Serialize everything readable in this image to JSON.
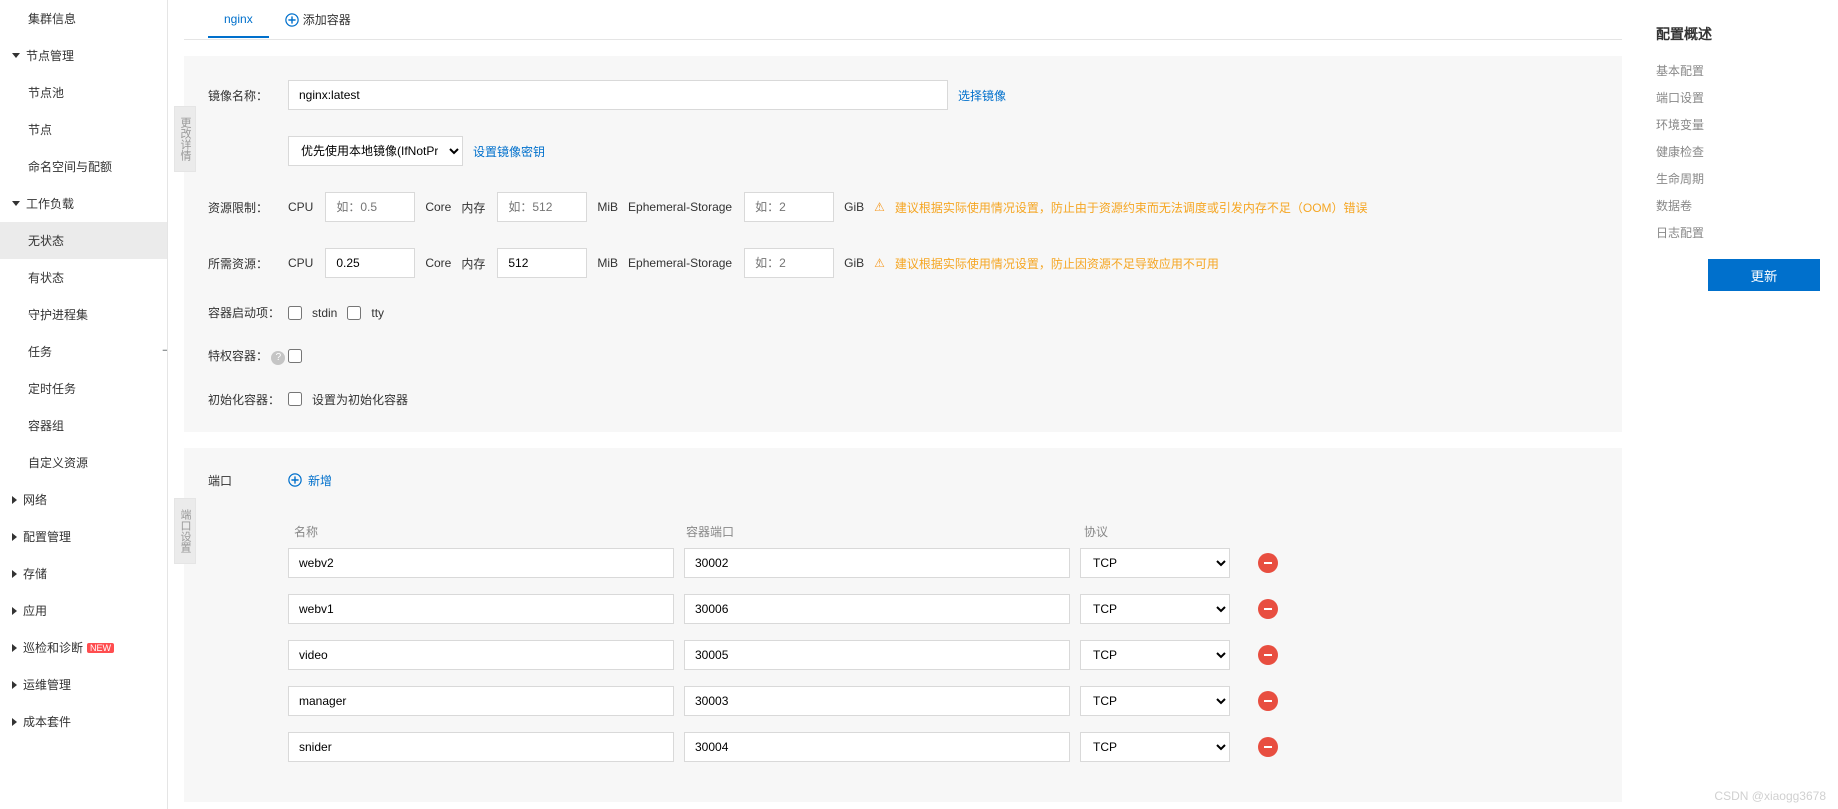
{
  "sidebar": {
    "items": [
      {
        "label": "集群信息"
      },
      {
        "label": "节点管理",
        "expanded": true,
        "children": [
          {
            "label": "节点池"
          },
          {
            "label": "节点"
          },
          {
            "label": "命名空间与配额"
          }
        ]
      },
      {
        "label": "工作负载",
        "expanded": true,
        "children": [
          {
            "label": "无状态",
            "active": true
          },
          {
            "label": "有状态"
          },
          {
            "label": "守护进程集"
          },
          {
            "label": "任务"
          },
          {
            "label": "定时任务"
          },
          {
            "label": "容器组"
          },
          {
            "label": "自定义资源"
          }
        ]
      },
      {
        "label": "网络"
      },
      {
        "label": "配置管理"
      },
      {
        "label": "存储"
      },
      {
        "label": "应用"
      },
      {
        "label": "巡检和诊断",
        "badge": "NEW"
      },
      {
        "label": "运维管理"
      },
      {
        "label": "成本套件"
      }
    ]
  },
  "tabs": {
    "active": "nginx",
    "add": "添加容器"
  },
  "form": {
    "image_label": "镜像名称：",
    "image_value": "nginx:latest",
    "select_image": "选择镜像",
    "pull_policy": "优先使用本地镜像(IfNotPresent)",
    "set_secret": "设置镜像密钥",
    "limit_label": "资源限制：",
    "request_label": "所需资源：",
    "cpu": "CPU",
    "core": "Core",
    "mem": "内存",
    "mib": "MiB",
    "eph": "Ephemeral-Storage",
    "gib": "GiB",
    "cpu_limit_ph": "如：0.5",
    "mem_limit_ph": "如：512",
    "eph_ph": "如：2",
    "cpu_req": "0.25",
    "mem_req": "512",
    "warn_limit": "建议根据实际使用情况设置，防止由于资源约束而无法调度或引发内存不足（OOM）错误",
    "warn_req": "建议根据实际使用情况设置，防止因资源不足导致应用不可用",
    "start_label": "容器启动项：",
    "stdin": "stdin",
    "tty": "tty",
    "priv_label": "特权容器：",
    "init_label": "初始化容器：",
    "init_cb": "设置为初始化容器",
    "vtab_overview": "更改详情"
  },
  "ports": {
    "section_label": "端口",
    "add": "新增",
    "headers": {
      "name": "名称",
      "port": "容器端口",
      "proto": "协议"
    },
    "rows": [
      {
        "name": "webv2",
        "port": "30002",
        "proto": "TCP"
      },
      {
        "name": "webv1",
        "port": "30006",
        "proto": "TCP"
      },
      {
        "name": "video",
        "port": "30005",
        "proto": "TCP"
      },
      {
        "name": "manager",
        "port": "30003",
        "proto": "TCP"
      },
      {
        "name": "snider",
        "port": "30004",
        "proto": "TCP"
      }
    ],
    "vtab": "端口设置"
  },
  "rightPanel": {
    "title": "配置概述",
    "items": [
      "基本配置",
      "端口设置",
      "环境变量",
      "健康检查",
      "生命周期",
      "数据卷",
      "日志配置"
    ],
    "update": "更新"
  },
  "watermark": "CSDN @xiaogg3678"
}
